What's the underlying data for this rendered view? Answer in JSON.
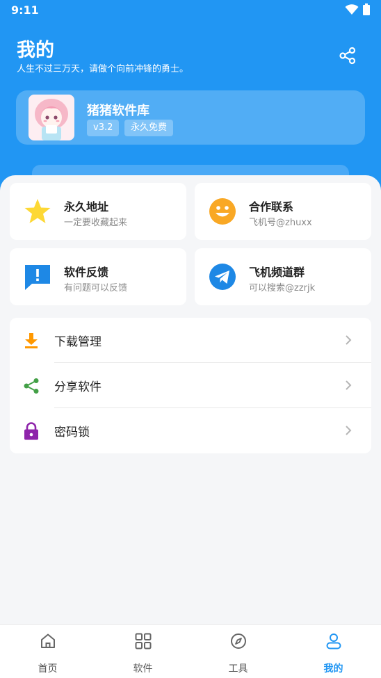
{
  "status_bar": {
    "time": "9:11"
  },
  "header": {
    "title": "我的",
    "subtitle": "人生不过三万天，请做个向前冲锋的勇士。",
    "share_icon": "share-icon"
  },
  "app_card": {
    "name": "猪猪软件库",
    "version": "v3.2",
    "free_label": "永久免费"
  },
  "tiles": [
    {
      "title": "永久地址",
      "subtitle": "一定要收藏起来",
      "icon": "star-icon",
      "color": "#fbc02d"
    },
    {
      "title": "合作联系",
      "subtitle": "飞机号@zhuxx",
      "icon": "smiley-icon",
      "color": "#f9a825"
    },
    {
      "title": "软件反馈",
      "subtitle": "有问题可以反馈",
      "icon": "feedback-icon",
      "color": "#2196f3"
    },
    {
      "title": "飞机频道群",
      "subtitle": "可以搜索@zzrjk",
      "icon": "telegram-icon",
      "color": "#1e88e5"
    }
  ],
  "menu": [
    {
      "label": "下载管理",
      "icon": "download-icon",
      "color": "#ff9800"
    },
    {
      "label": "分享软件",
      "icon": "share-icon",
      "color": "#4caf50"
    },
    {
      "label": "密码锁",
      "icon": "lock-icon",
      "color": "#8e24aa"
    }
  ],
  "bottom_nav": [
    {
      "label": "首页",
      "icon": "home-icon",
      "active": false
    },
    {
      "label": "软件",
      "icon": "grid-icon",
      "active": false
    },
    {
      "label": "工具",
      "icon": "compass-icon",
      "active": false
    },
    {
      "label": "我的",
      "icon": "user-icon",
      "active": true
    }
  ],
  "colors": {
    "primary": "#2196f3",
    "background": "#f5f6f8"
  }
}
